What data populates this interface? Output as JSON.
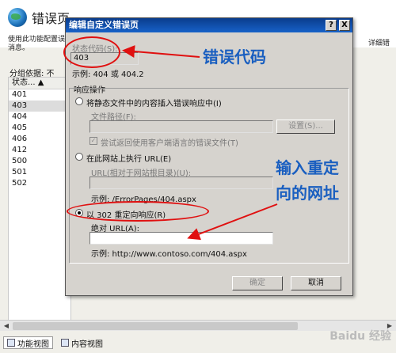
{
  "background": {
    "title": "错误页",
    "description": "使用此功能配置误消息。",
    "description_right": "详细错",
    "group_by_label": "分组依据: 不",
    "table_header": "状态... ▲",
    "status_codes": [
      "401",
      "403",
      "404",
      "405",
      "406",
      "412",
      "500",
      "501",
      "502"
    ]
  },
  "bottom_tabs": {
    "features_view": "功能视图",
    "content_view": "内容视图"
  },
  "watermark": "Baidu 经验",
  "dialog": {
    "title": "编辑自定义错误页",
    "help_btn": "?",
    "close_btn": "X",
    "status_code_label": "状态代码(S):",
    "status_code_value": "403",
    "status_example": "示例: 404 或 404.2",
    "response_group_label": "响应操作",
    "option_static": "将静态文件中的内容插入错误响应中(I)",
    "file_path_label": "文件路径(F):",
    "file_path_value": "",
    "settings_btn": "设置(S)...",
    "try_language_label": "尝试返回使用客户端语言的错误文件(T)",
    "option_execute": "在此网站上执行 URL(E)",
    "url_label": "URL(相对于网站根目录)(U):",
    "url_value": "",
    "url_example": "示例: /ErrorPages/404.aspx",
    "option_redirect": "以 302 重定向响应(R)",
    "absolute_url_label": "绝对 URL(A):",
    "absolute_url_value": "",
    "absolute_url_example": "示例: http://www.contoso.com/404.aspx",
    "ok_btn": "确定",
    "cancel_btn": "取消"
  },
  "annotations": {
    "error_code": "错误代码",
    "redirect_line1": "输入重定",
    "redirect_line2": "向的网址"
  },
  "colors": {
    "annotation_red": "#e01010",
    "annotation_blue": "#1a5fc0",
    "titlebar_blue": "#0a3c8c"
  }
}
